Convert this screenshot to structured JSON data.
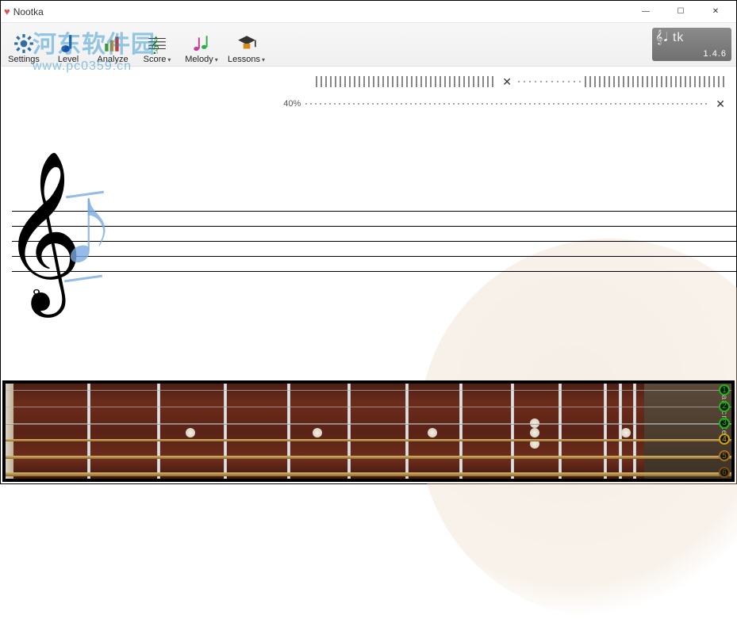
{
  "window": {
    "title": "Nootka",
    "min": "—",
    "max": "☐",
    "close": "✕"
  },
  "toolbar": {
    "settings": "Settings",
    "level": "Level",
    "analyze": "Analyze",
    "score": "Score",
    "melody": "Melody",
    "lessons": "Lessons"
  },
  "version": "1.4.6",
  "sliders": {
    "volume_label": "40%",
    "right_icon": "✕"
  },
  "watermark": {
    "line1": "河东软件园",
    "line2": "www.pc0359.cn"
  },
  "staff": {
    "clef_octave": "8"
  },
  "headstock": {
    "text": "handcrafted"
  },
  "strings": [
    {
      "num": "1",
      "color": "#1db51a"
    },
    {
      "num": "2",
      "color": "#1db51a"
    },
    {
      "num": "3",
      "color": "#1db51a"
    },
    {
      "num": "4",
      "color": "#d3a10e"
    },
    {
      "num": "5",
      "color": "#a86a1a"
    },
    {
      "num": "6",
      "color": "#7b4a18"
    }
  ],
  "frets": {
    "count": 12,
    "dot_positions": [
      3,
      5,
      7,
      9,
      12
    ],
    "double_dot_at": 12
  }
}
